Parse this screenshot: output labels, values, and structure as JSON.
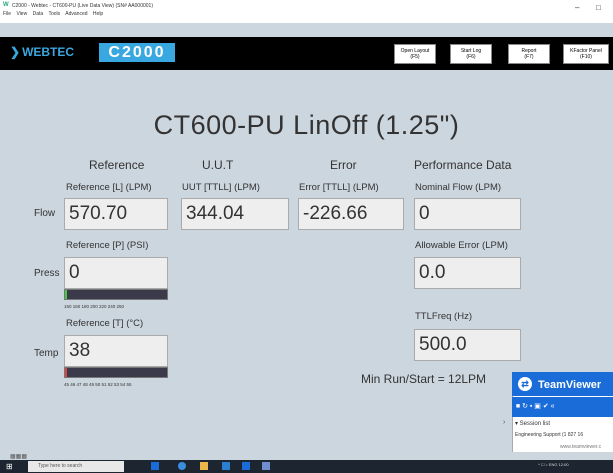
{
  "window": {
    "title": "C2000 - Webtec - CT600-PU (Live Data View) (SN# AA000001)",
    "app_icon_glyph": "W",
    "menu": [
      "File",
      "View",
      "Data",
      "Tools",
      "Advanced",
      "Help"
    ],
    "minimize_glyph": "–",
    "maximize_glyph": "□"
  },
  "toolbar": {
    "logo_webtec": "WEBTEC",
    "logo_c2000": "C2000",
    "buttons": [
      {
        "line1": "Open Layout",
        "line2": "(F5)"
      },
      {
        "line1": "Start Log",
        "line2": "(F6)"
      },
      {
        "line1": "Report",
        "line2": "(F7)"
      },
      {
        "line1": "KFactor Panel",
        "line2": "(F10)"
      }
    ]
  },
  "main": {
    "title": "CT600-PU  LinOff (1.25\")",
    "columns": {
      "reference": "Reference",
      "uut": "U.U.T",
      "error": "Error",
      "performance": "Performance Data"
    },
    "rows": {
      "flow": "Flow",
      "press": "Press",
      "temp": "Temp"
    },
    "flow": {
      "reference_label": "Reference [L] (LPM)",
      "reference_value": "570.70",
      "uut_label": "UUT [TTLL] (LPM)",
      "uut_value": "344.04",
      "error_label": "Error [TTLL] (LPM)",
      "error_value": "-226.66"
    },
    "press": {
      "label": "Reference [P] (PSI)",
      "value": "0",
      "bar_fraction": 0.02,
      "ticks": "150  160    180    200    220     240  250"
    },
    "temp": {
      "label": "Reference [T] (°C)",
      "value": "38",
      "bar_fraction": 0.02,
      "ticks": "45  46  47  48  49  50  51  52  53  54  55"
    },
    "performance": {
      "nominal_label": "Nominal Flow (LPM)",
      "nominal_value": "0",
      "allowable_label": "Allowable Error (LPM)",
      "allowable_value": "0.0",
      "ttlfreq_label": "TTLFreq (Hz)",
      "ttlfreq_value": "500.0"
    },
    "min_run": "Min Run/Start = 12LPM"
  },
  "teamviewer": {
    "name": "TeamViewer",
    "session_list": "▾ Session list",
    "item": "Engineering Support (1 827 16",
    "url": "www.teamviewer.c",
    "tools": "■  ↻  ▪  ▣  ✔  «"
  },
  "taskbar": {
    "search_placeholder": "Type here to search",
    "tray": "^  ☐  ♪  ENG  12:00"
  }
}
